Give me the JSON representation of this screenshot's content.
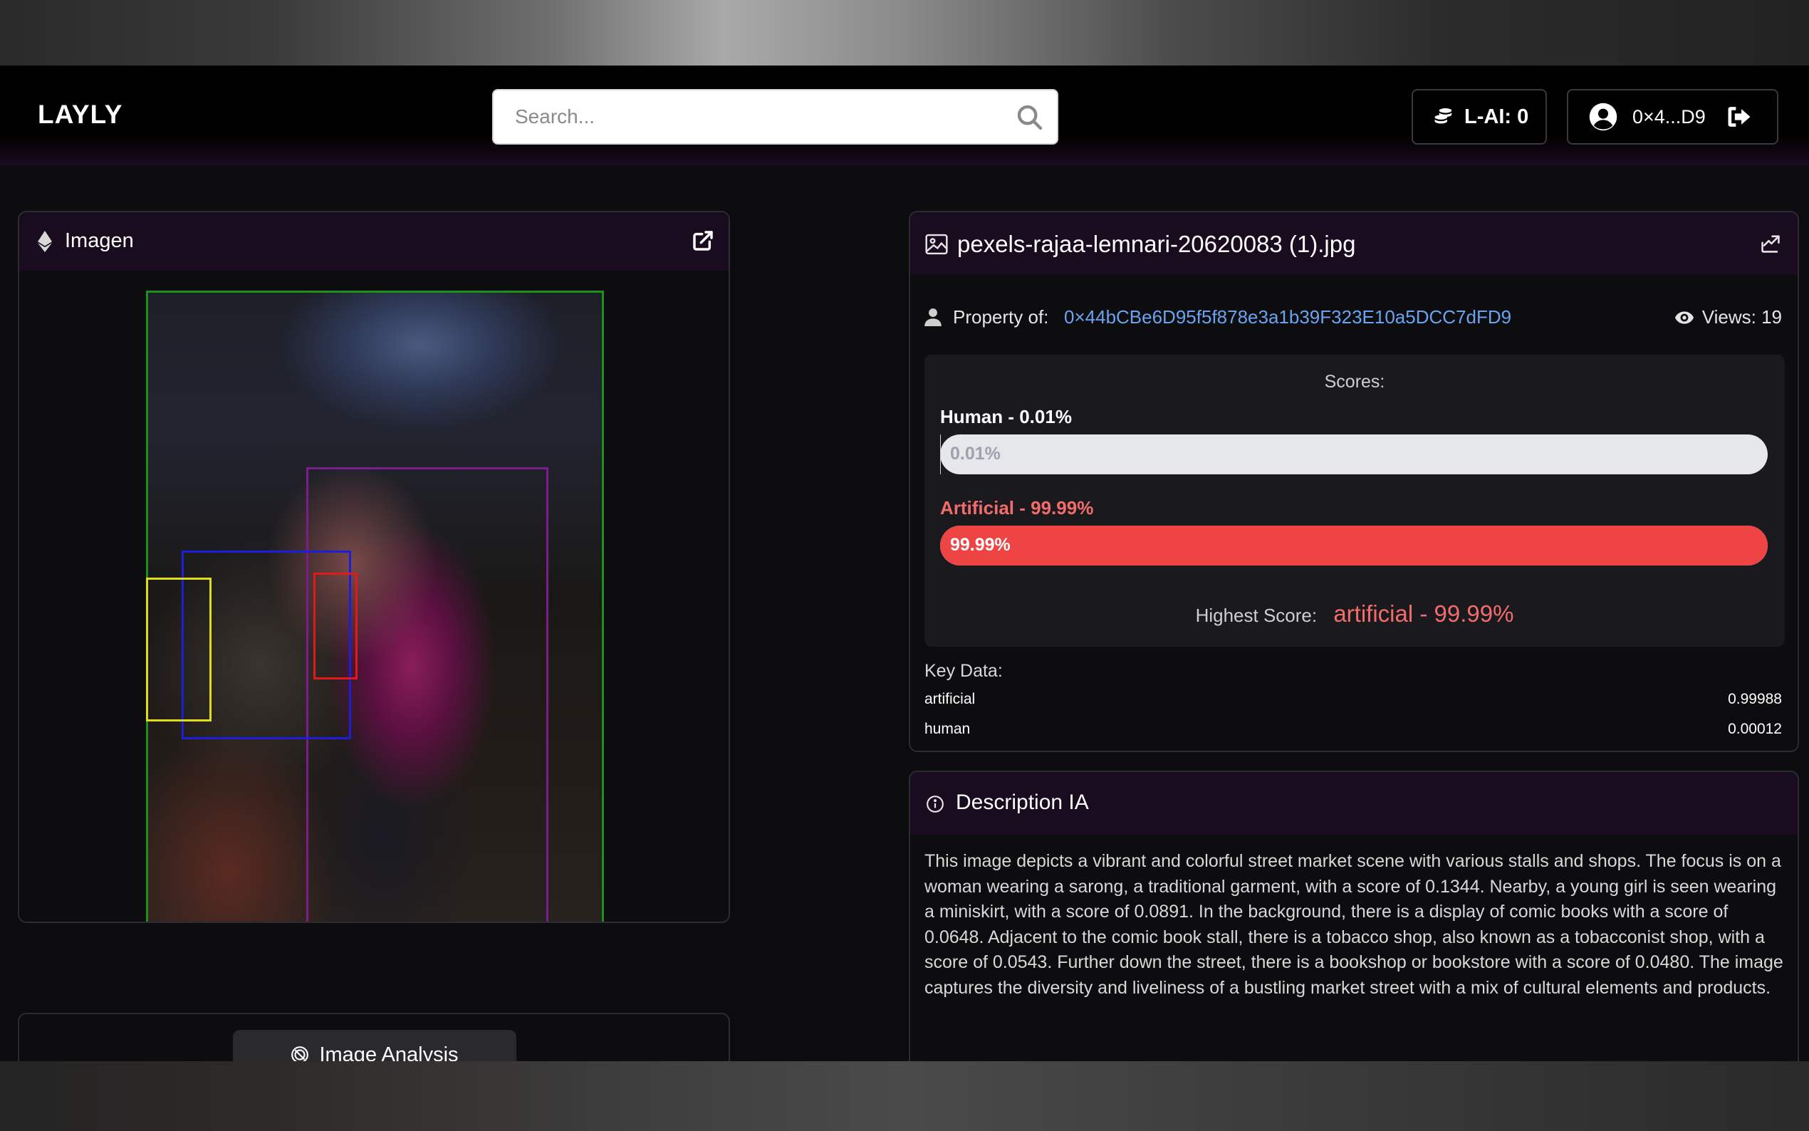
{
  "header": {
    "brand": "LAYLY",
    "search_placeholder": "Search...",
    "credits_label": "L-AI: 0",
    "wallet_address": "0×4...D9"
  },
  "image_panel": {
    "title": "Imagen",
    "analysis_tab": "Image Analysis"
  },
  "file_panel": {
    "file_name": "pexels-rajaa-lemnari-20620083 (1).jpg",
    "property_label": "Property of:",
    "owner_address": "0×44bCBe6D95f5f878e3a1b39F323E10a5DCC7dFD9",
    "views_label": "Views: 19",
    "scores": {
      "header": "Scores:",
      "human_label": "Human - 0.01%",
      "human_bar_text": "0.01%",
      "human_fraction": 0.0001,
      "artificial_label": "Artificial - 99.99%",
      "artificial_bar_text": "99.99%",
      "artificial_fraction": 0.9999,
      "highest_label": "Highest Score:",
      "highest_value": "artificial - 99.99%"
    },
    "key_data": {
      "title": "Key Data:",
      "rows": [
        {
          "label": "artificial",
          "value": "0.99988"
        },
        {
          "label": "human",
          "value": "0.00012"
        }
      ]
    }
  },
  "description_panel": {
    "title": "Description IA",
    "body": "This image depicts a vibrant and colorful street market scene with various stalls and shops. The focus is on a woman wearing a sarong, a traditional garment, with a score of 0.1344. Nearby, a young girl is seen wearing a miniskirt, with a score of 0.0891. In the background, there is a display of comic books with a score of 0.0648. Adjacent to the comic book stall, there is a tobacco shop, also known as a tobacconist shop, with a score of 0.0543. Further down the street, there is a bookshop or bookstore with a score of 0.0480. The image captures the diversity and liveliness of a bustling market street with a mix of cultural elements and products."
  },
  "colors": {
    "accent_red": "#ef4444",
    "link_blue": "#6aa4f0",
    "panel_header": "#1a0c1f",
    "bbox_colors": [
      "#1f8f1f",
      "#7a1e8e",
      "#1e1ed8",
      "#e0dc1a",
      "#e01a1a"
    ]
  },
  "icons": [
    "search-icon",
    "coins-icon",
    "user-circle-icon",
    "logout-icon",
    "ethereum-icon",
    "external-link-icon",
    "image-icon",
    "share-icon",
    "user-icon",
    "eye-icon",
    "info-icon",
    "analysis-icon"
  ]
}
